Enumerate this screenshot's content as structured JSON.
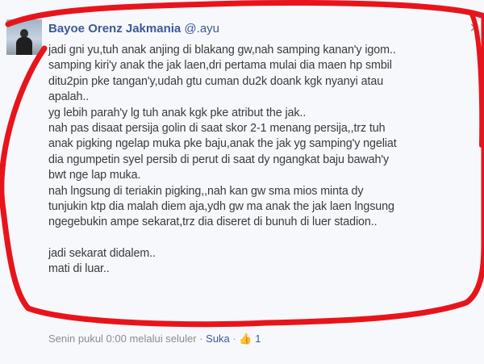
{
  "post": {
    "author": "Bayoe Orenz Jakmania",
    "mention": "@.ayu",
    "lines": [
      "jadi gni yu,tuh anak anjing di blakang gw,nah samping kanan'y igom..",
      "samping kiri'y anak the jak laen,dri pertama mulai dia maen hp smbil",
      "ditu2pin pke tangan'y,udah gtu cuman du2k doank kgk nyanyi atau",
      "apalah..",
      "yg lebih parah'y lg tuh anak kgk pke atribut the jak..",
      "nah pas disaat persija golin di saat skor 2-1 menang persija,,trz tuh",
      "anak pigking ngelap muka pke baju,anak the jak yg samping'y ngeliat",
      "dia ngumpetin syel persib di perut di saat dy ngangkat baju bawah'y",
      "bwt nge lap muka.",
      "nah lngsung di teriakin pigking,,nah kan gw sma mios minta dy",
      "tunjukin ktp dia malah diem aja,ydh gw ma anak the jak laen lngsung",
      "ngegebukin ampe sekarat,trz dia diseret di bunuh di luer stadion..",
      "",
      "jadi sekarat didalem..",
      "mati di luar.."
    ],
    "footer": {
      "timestamp": "Senin pukul 0:00 melalui seluler",
      "separator": "·",
      "like_label": "Suka",
      "like_count": "1"
    },
    "close_glyph": "×"
  },
  "annotation_color": "#e8141b"
}
